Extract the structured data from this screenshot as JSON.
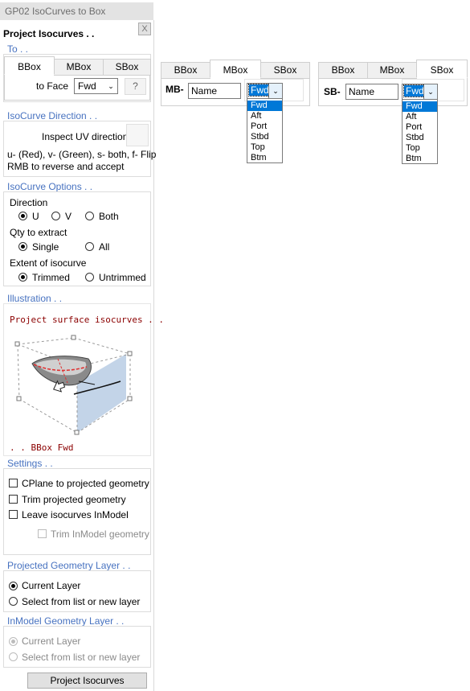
{
  "window": {
    "title": "GP02 IsoCurves to Box",
    "close_glyph": "X"
  },
  "panel": {
    "heading": "Project Isocurves . .",
    "to": {
      "title": "To . .",
      "tabs": [
        "BBox",
        "MBox",
        "SBox"
      ],
      "face_label": "to Face",
      "face_value": "Fwd",
      "help_label": "?"
    },
    "isocurve_direction": {
      "title": "IsoCurve Direction . .",
      "inspect_label": "Inspect UV direction",
      "hint1": "u- (Red), v- (Green), s- both, f- Flip",
      "hint2": "RMB to reverse and accept"
    },
    "isocurve_options": {
      "title": "IsoCurve Options . .",
      "direction_label": "Direction",
      "direction_options": [
        "U",
        "V",
        "Both"
      ],
      "qty_label": "Qty to extract",
      "qty_options": [
        "Single",
        "All"
      ],
      "extent_label": "Extent of isocurve",
      "extent_options": [
        "Trimmed",
        "Untrimmed"
      ]
    },
    "illustration": {
      "title": "Illustration . .",
      "caption_top": "Project surface isocurves . .",
      "caption_bottom": ". . BBox Fwd"
    },
    "settings": {
      "title": "Settings . .",
      "cplane": "CPlane to projected geometry",
      "trim": "Trim projected geometry",
      "leave": "Leave isocurves InModel",
      "trim_inmodel": "Trim InModel geometry"
    },
    "projected_layer": {
      "title": "Projected Geometry Layer . .",
      "current": "Current Layer",
      "select": "Select from list or new layer"
    },
    "inmodel_layer": {
      "title": "InModel Geometry Layer . .",
      "current": "Current Layer",
      "select": "Select from list or new layer"
    },
    "run_button": "Project Isocurves"
  },
  "mbox_view": {
    "tabs": [
      "BBox",
      "MBox",
      "SBox"
    ],
    "prefix": "MB-",
    "name_value": "Name",
    "face_value": "Fwd",
    "options": [
      "Fwd",
      "Aft",
      "Port",
      "Stbd",
      "Top",
      "Btm"
    ]
  },
  "sbox_view": {
    "tabs": [
      "BBox",
      "MBox",
      "SBox"
    ],
    "prefix": "SB-",
    "name_value": "Name",
    "face_value": "Fwd",
    "options": [
      "Fwd",
      "Aft",
      "Port",
      "Stbd",
      "Top",
      "Btm"
    ]
  },
  "colors": {
    "section_title": "#4772c0",
    "illustration_text": "#8b0000",
    "selection": "#0078d7"
  }
}
